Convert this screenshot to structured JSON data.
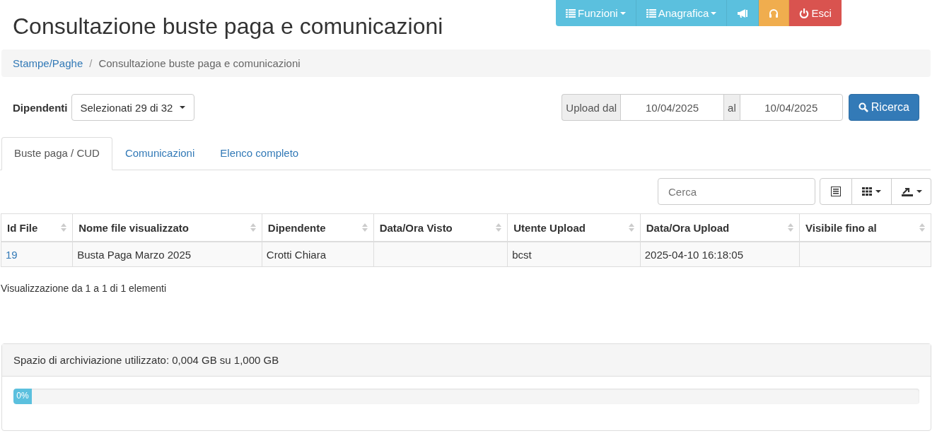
{
  "top_nav": [
    {
      "kind": "dropdown",
      "label": "Funzioni",
      "color": "#5bc0de"
    },
    {
      "kind": "dropdown",
      "label": "Anagrafica",
      "color": "#5bc0de"
    },
    {
      "kind": "megaphone",
      "color": "#5bc0de"
    },
    {
      "kind": "headphones",
      "color": "#f0ad4e"
    },
    {
      "kind": "power",
      "label": "Esci",
      "color": "#d9534f"
    }
  ],
  "page_title": "Consultazione buste paga e comunicazioni",
  "breadcrumb_separator": "/",
  "breadcrumb": [
    {
      "label": "Stampe/Paghe",
      "link": true
    },
    {
      "label": "Consultazione buste paga e comunicazioni",
      "link": false
    }
  ],
  "filters": {
    "employees_label": "Dipendenti",
    "employees_value": "Selezionati 29 di 32",
    "upload_from_label": "Upload dal",
    "upload_from": "10/04/2025",
    "upload_to_label": "al",
    "upload_to": "10/04/2025",
    "search_button": "Ricerca"
  },
  "tabs": [
    {
      "label": "Buste paga / CUD",
      "selected": true
    },
    {
      "label": "Comunicazioni",
      "selected": false
    },
    {
      "label": "Elenco completo",
      "selected": false
    }
  ],
  "table_search": {
    "placeholder": "Cerca"
  },
  "table": {
    "columns": [
      "Id File",
      "Nome file visualizzato",
      "Dipendente",
      "Data/Ora Visto",
      "Utente Upload",
      "Data/Ora Upload",
      "Visibile fino al"
    ],
    "rows": [
      [
        "19",
        "Busta Paga Marzo 2025",
        "Crotti Chiara",
        "",
        "bcst",
        "2025-04-10 16:18:05",
        ""
      ]
    ]
  },
  "table_info": "Visualizzazione da 1 a 1 di 1 elementi",
  "storage": {
    "heading": "Spazio di archiviazione utilizzato: 0,004 GB su 1,000 GB",
    "level": 0.004,
    "reading": "0%"
  }
}
